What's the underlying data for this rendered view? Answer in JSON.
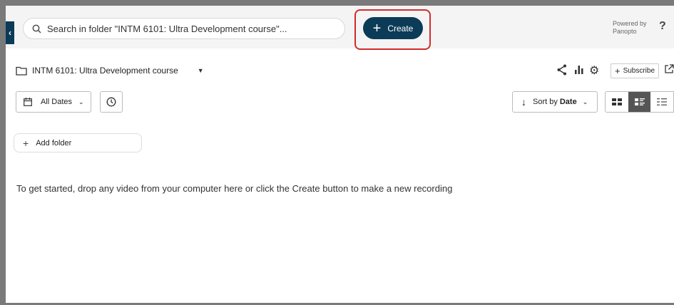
{
  "header": {
    "search": {
      "placeholder": "Search in folder \"INTM 6101: Ultra Development course\"...",
      "value": ""
    },
    "create_label": "Create",
    "powered_line1": "Powered by",
    "powered_line2": "Panopto",
    "help_label": "?"
  },
  "folder": {
    "name": "INTM 6101: Ultra Development course",
    "subscribe_label": "Subscribe"
  },
  "filters": {
    "dates_label": "All Dates",
    "sort_prefix": "Sort by",
    "sort_value": "Date"
  },
  "add_folder_label": "Add folder",
  "empty_message": "To get started, drop any video from your computer here or click the Create button to make a new recording",
  "colors": {
    "accent": "#0b3b57",
    "highlight": "#d42a2a",
    "header_bg": "#f4f4f4"
  }
}
